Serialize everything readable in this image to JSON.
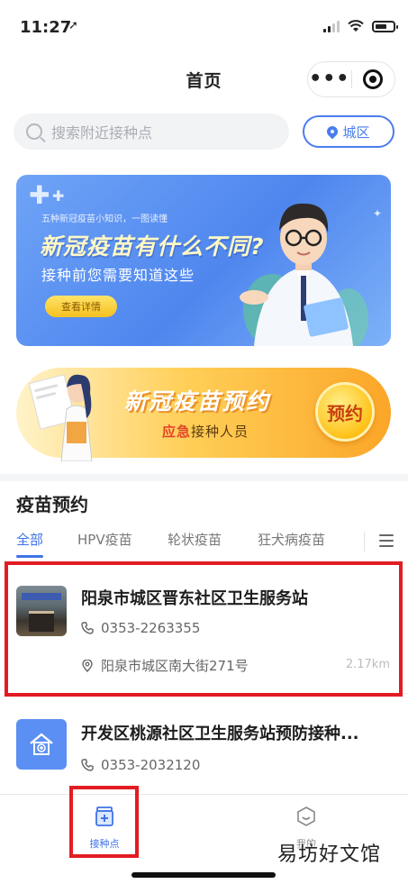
{
  "status_bar": {
    "time": "11:27"
  },
  "nav": {
    "title": "首页",
    "more_label": "•••"
  },
  "search": {
    "placeholder": "搜索附近接种点",
    "district_label": "城区"
  },
  "banner_primary": {
    "kicker": "五种新冠疫苗小知识，一图读懂",
    "title": "新冠疫苗有什么不同?",
    "subtitle": "接种前您需要知道这些",
    "button_label": "查看详情"
  },
  "banner_secondary": {
    "title": "新冠疫苗预约",
    "subtitle_accent": "应急",
    "subtitle_rest": "接种人员",
    "badge": "预约"
  },
  "section": {
    "title": "疫苗预约"
  },
  "tabs": [
    {
      "label": "全部",
      "active": true
    },
    {
      "label": "HPV疫苗"
    },
    {
      "label": "轮状疫苗"
    },
    {
      "label": "狂犬病疫苗"
    }
  ],
  "sites": [
    {
      "name": "阳泉市城区晋东社区卫生服务站",
      "phone": "0353-2263355",
      "address": "阳泉市城区南大街271号",
      "distance": "2.17km"
    },
    {
      "name": "开发区桃源社区卫生服务站预防接种...",
      "phone": "0353-2032120"
    }
  ],
  "tabbar": [
    {
      "label": "接种点",
      "icon": "vaccine-box-icon",
      "active": true
    },
    {
      "label": "我的",
      "icon": "smile-face-icon"
    }
  ],
  "watermark": "易坊好文馆",
  "colors": {
    "accent": "#3f73e8",
    "highlight": "#e31c23"
  }
}
